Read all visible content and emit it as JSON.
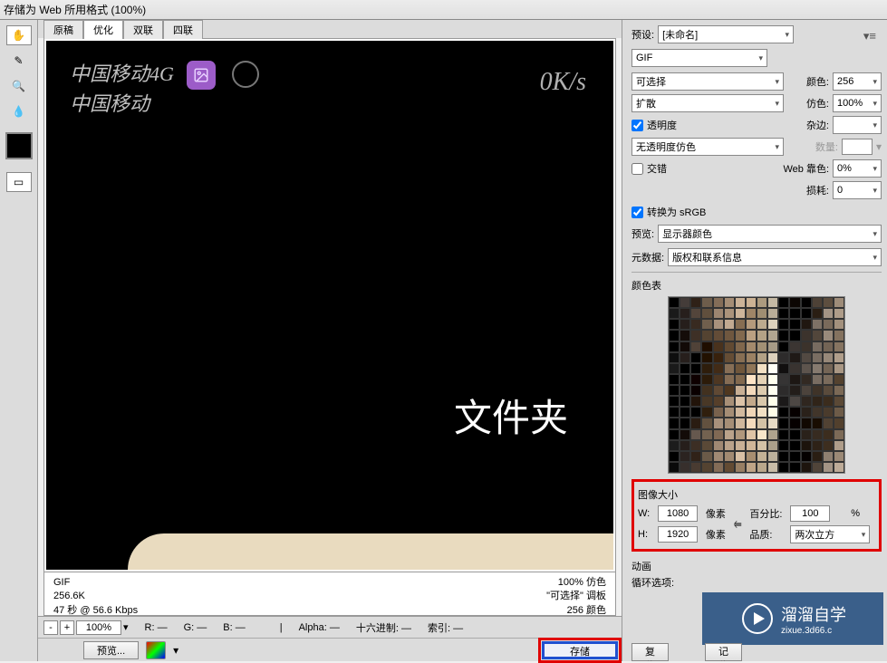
{
  "title": "存储为 Web 所用格式 (100%)",
  "tabs": [
    "原稿",
    "优化",
    "双联",
    "四联"
  ],
  "activeTab": 1,
  "image": {
    "carrier1": "中国移动4G",
    "carrier2": "中国移动",
    "speed": "0K/s",
    "folderLabel": "文件夹"
  },
  "stats": {
    "format": "GIF",
    "size": "256.6K",
    "time": "47 秒 @ 56.6 Kbps",
    "dither": "100% 仿色",
    "palette": "\"可选择\" 调板",
    "colors": "256 颜色"
  },
  "zoom": "100%",
  "bottombar": {
    "r": "R: —",
    "g": "G: —",
    "b": "B: —",
    "alpha": "Alpha: —",
    "hex": "十六进制: —",
    "index": "索引: —"
  },
  "buttons": {
    "preview": "预览...",
    "save": "存储",
    "reset": "复位",
    "remember": "记住"
  },
  "right": {
    "preset_label": "预设:",
    "preset": "[未命名]",
    "format": "GIF",
    "palette": "可选择",
    "colors_label": "颜色:",
    "colors": "256",
    "dither_method": "扩散",
    "dither_label": "仿色:",
    "dither": "100%",
    "transparency": "透明度",
    "matte_label": "杂边:",
    "trans_dither": "无透明度仿色",
    "amount_label": "数量:",
    "interlace": "交错",
    "web_snap_label": "Web 靠色:",
    "web_snap": "0%",
    "lossy_label": "损耗:",
    "lossy": "0",
    "convert_srgb": "转换为 sRGB",
    "preview_opt_label": "预览:",
    "preview_opt": "显示器颜色",
    "metadata_label": "元数据:",
    "metadata": "版权和联系信息",
    "color_table": "颜色表",
    "image_size": "图像大小",
    "w_label": "W:",
    "w": "1080",
    "px": "像素",
    "h_label": "H:",
    "h": "1920",
    "percent_label": "百分比:",
    "percent": "100",
    "quality_label": "品质:",
    "quality": "两次立方",
    "animation": "动画",
    "loop_label": "循环选项:",
    "logo": "溜溜自学",
    "logo_sub": "zixue.3d66.c"
  }
}
